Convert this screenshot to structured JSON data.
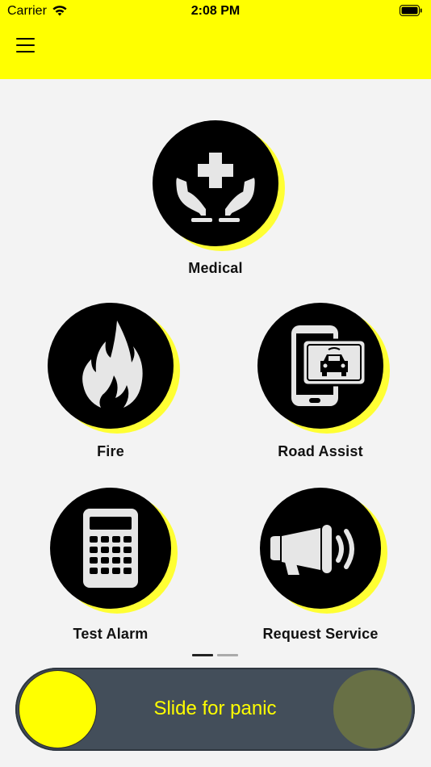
{
  "status_bar": {
    "carrier": "Carrier",
    "time": "2:08 PM"
  },
  "header": {
    "background_color": "#ffff00",
    "menu_icon": "hamburger-menu-icon"
  },
  "tiles": {
    "medical": {
      "label": "Medical",
      "icon": "medical-hands-cross-icon"
    },
    "fire": {
      "label": "Fire",
      "icon": "flame-icon"
    },
    "road_assist": {
      "label": "Road Assist",
      "icon": "phone-car-icon"
    },
    "test_alarm": {
      "label": "Test Alarm",
      "icon": "calculator-icon"
    },
    "request_service": {
      "label": "Request Service",
      "icon": "megaphone-icon"
    }
  },
  "pager": {
    "pages": 2,
    "active_index": 0,
    "active_color": "#222222",
    "inactive_color": "#aaaaaa"
  },
  "panic_slider": {
    "text": "Slide for panic",
    "track_color": "#434e5a",
    "knob_color": "#ffff00",
    "target_color": "#687045",
    "text_color": "#ffff00"
  }
}
